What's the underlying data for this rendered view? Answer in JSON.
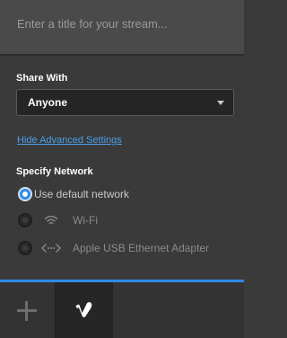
{
  "stream": {
    "title_placeholder": "Enter a title for your stream...",
    "title_value": ""
  },
  "share": {
    "label": "Share With",
    "selected": "Anyone"
  },
  "advanced_link": "Hide Advanced Settings",
  "network": {
    "label": "Specify Network",
    "options": [
      {
        "label": "Use default network",
        "selected": true,
        "icon": "none"
      },
      {
        "label": "Wi-Fi",
        "selected": false,
        "icon": "wifi-icon"
      },
      {
        "label": "Apple USB Ethernet Adapter",
        "selected": false,
        "icon": "ethernet-icon"
      }
    ]
  },
  "footer": {
    "tabs": [
      {
        "name": "add-destination",
        "icon": "plus-icon",
        "active": false
      },
      {
        "name": "vimeo",
        "icon": "vimeo-logo-icon",
        "active": true
      }
    ]
  },
  "colors": {
    "accent": "#2f8ae8",
    "link": "#4a9fe8",
    "background": "#3a3a3a"
  }
}
